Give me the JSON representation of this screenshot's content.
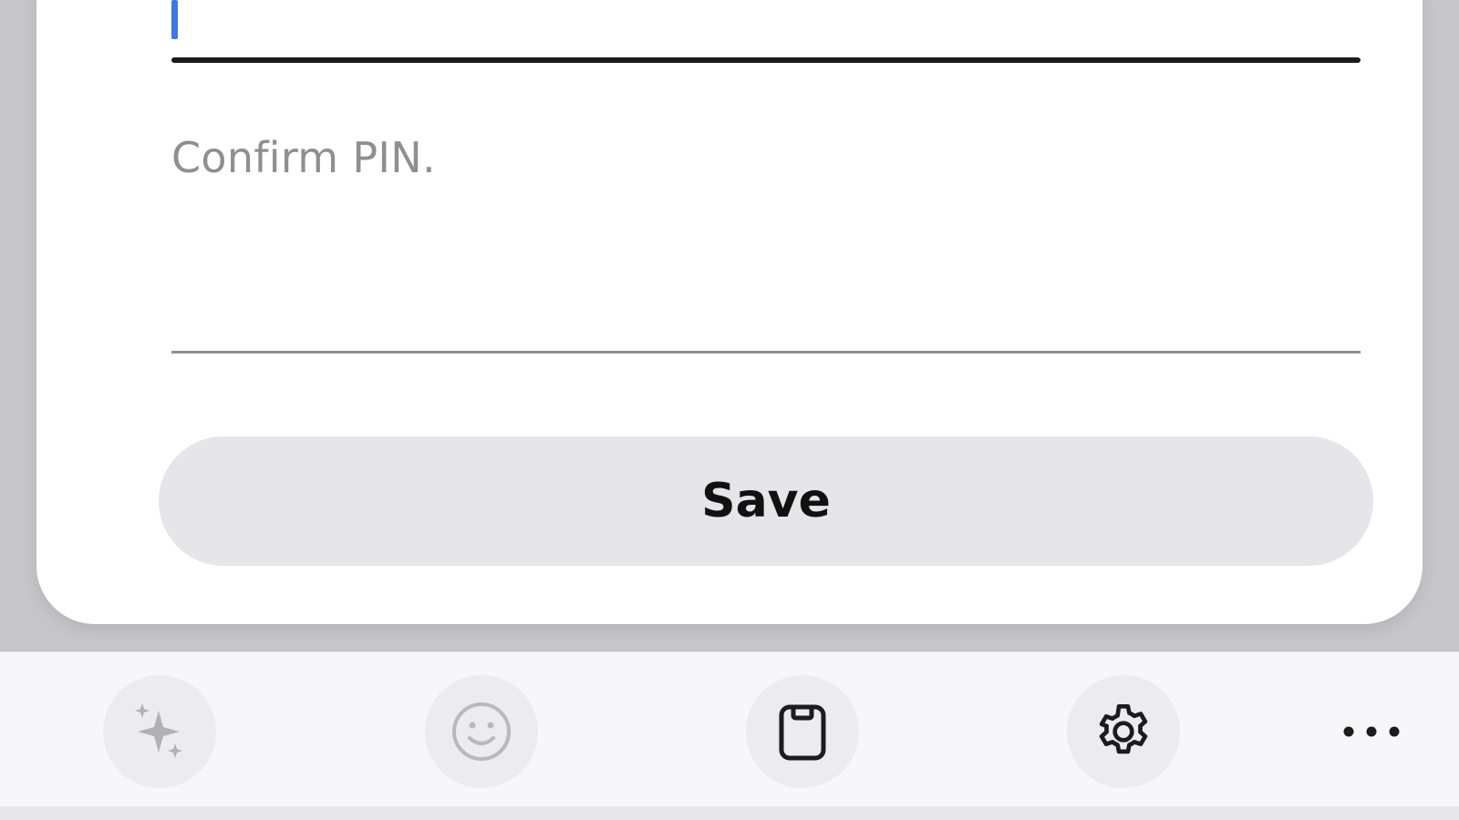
{
  "form": {
    "confirm_pin_placeholder": "Confirm PIN.",
    "save_label": "Save"
  },
  "toolbar": {
    "items": [
      {
        "icon": "sparkles-icon"
      },
      {
        "icon": "smiley-icon"
      },
      {
        "icon": "clipboard-icon"
      },
      {
        "icon": "gear-icon"
      },
      {
        "icon": "more-icon"
      }
    ]
  },
  "colors": {
    "accent_caret": "#3b78e7",
    "button_bg": "#e5e5ea",
    "placeholder": "#8e8e93"
  }
}
